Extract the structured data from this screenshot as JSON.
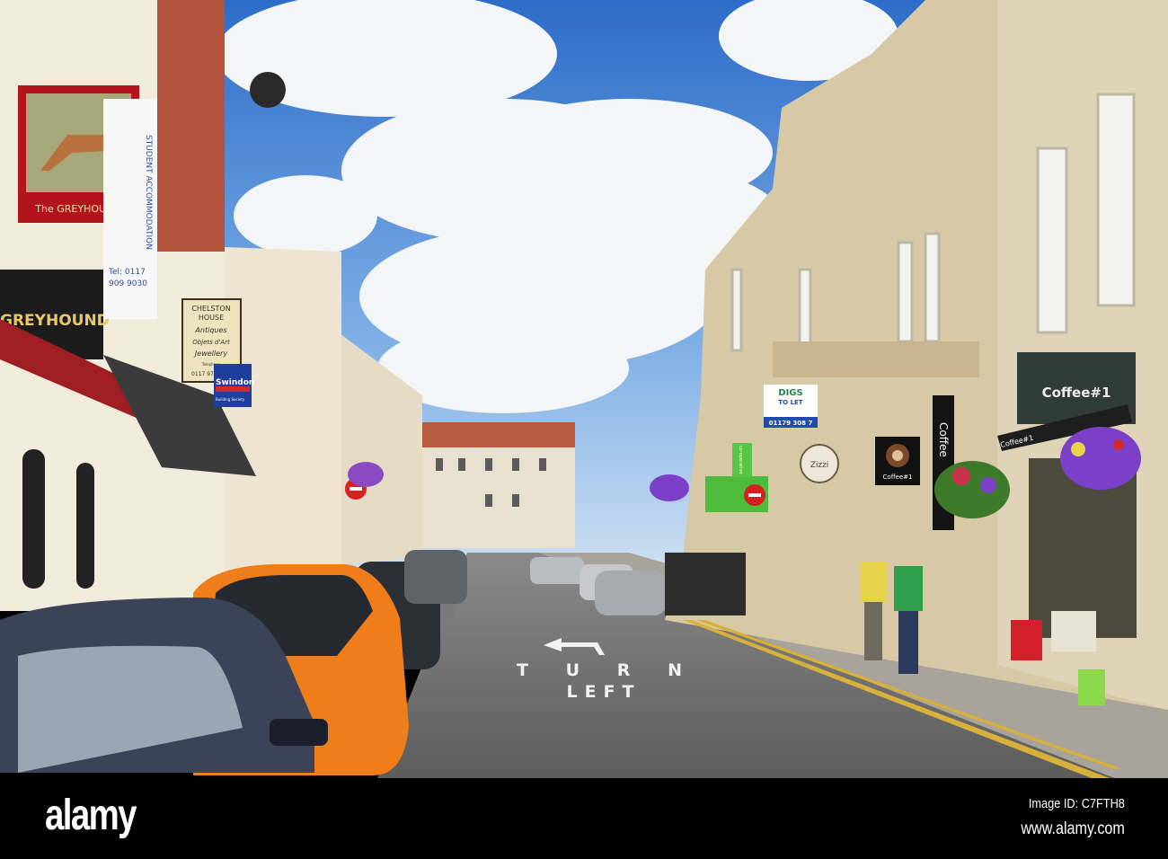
{
  "photo": {
    "signs": {
      "pub_sign": "The GREYHOUND",
      "pub_fascia": "GREYHOUND",
      "student_banner": "STUDENT ACCOMMODATION",
      "student_tel_1": "Tel: 0117",
      "student_tel_2": "909 9030",
      "antiques_1": "CHELSTON",
      "antiques_2": "HOUSE",
      "antiques_3": "Antiques",
      "antiques_4": "Objets d'Art",
      "antiques_5": "Jewellery",
      "antiques_6": "Telephone",
      "antiques_7": "0117 9735561",
      "swindon": "Swindon",
      "swindon_sub": "Building Society",
      "digs_1": "DIGS",
      "digs_2": "TO LET",
      "digs_3": "01179 308 7",
      "zizzi": "Zizzi",
      "coffee_square": "Coffee#1",
      "coffee_blade": "Coffee",
      "coffee_fascia": "Coffee#1",
      "coffee_awning": "Coffee#1",
      "coop": "co-operative",
      "road_1": "TURN",
      "road_2": "LEFT"
    },
    "colors": {
      "sky": "#3f7fd0",
      "stone": "#d8c9a6",
      "road": "#707070",
      "pub_red": "#b3141c"
    }
  },
  "watermark": {
    "logo": "alamy",
    "image_id": "Image ID: C7FTH8",
    "url": "www.alamy.com"
  }
}
